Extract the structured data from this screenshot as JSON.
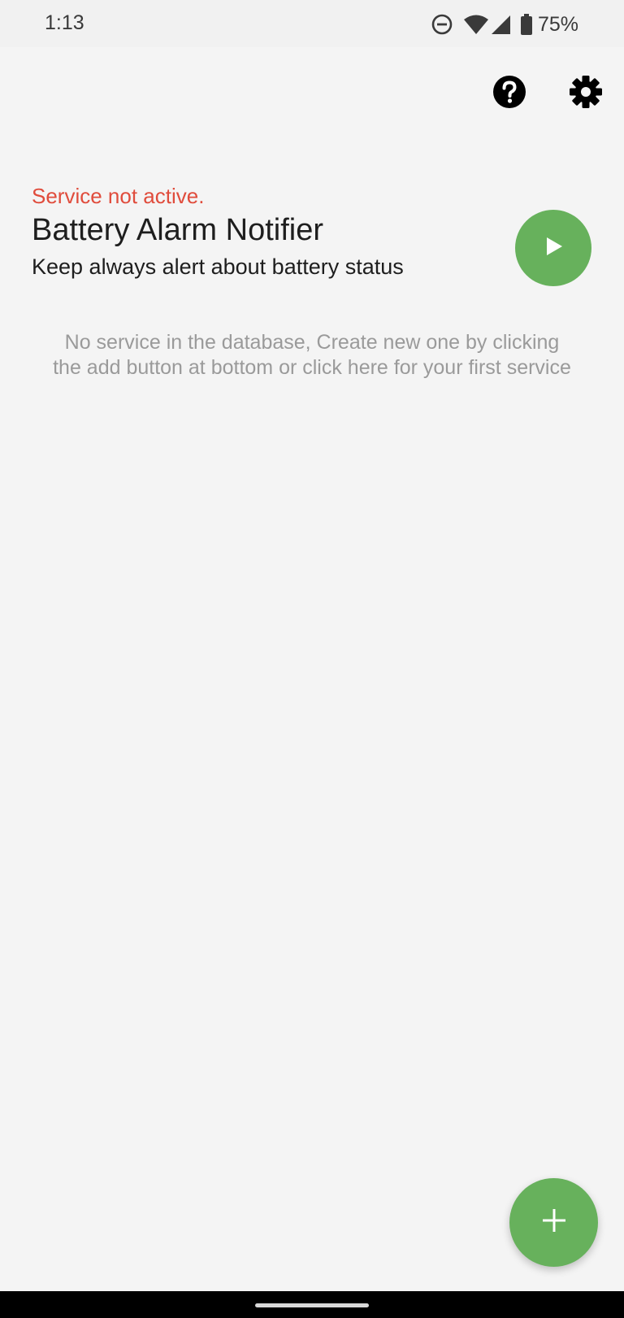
{
  "status_bar": {
    "time": "1:13",
    "battery_percent": "75%",
    "icons": [
      "do-not-disturb-icon",
      "wifi-icon",
      "cellular-signal-icon",
      "battery-icon"
    ]
  },
  "toolbar": {
    "help_icon": "help-icon",
    "settings_icon": "gear-icon"
  },
  "service": {
    "status": "Service not active.",
    "title": "Battery Alarm Notifier",
    "subtitle": "Keep always alert about battery status",
    "start_icon": "play-icon"
  },
  "empty_state": {
    "message": "No service in the database, Create new one by clicking the add button at bottom or click here for your first service"
  },
  "fab": {
    "icon": "plus-icon"
  },
  "colors": {
    "accent_green": "#67b15c",
    "status_red": "#e04c3c",
    "background": "#f4f4f4",
    "muted_text": "#9a9a9a"
  }
}
